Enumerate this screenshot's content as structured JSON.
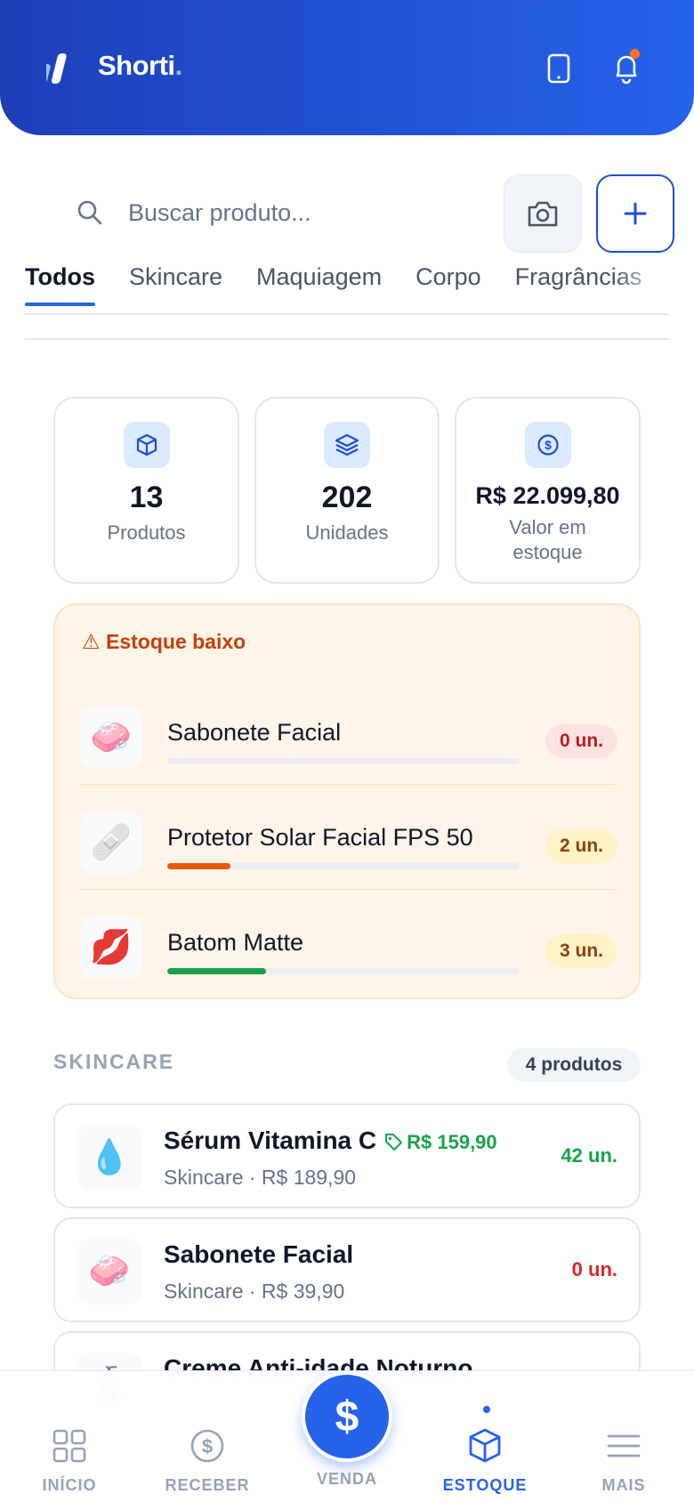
{
  "app": {
    "name": "Shorti",
    "name_dot": "."
  },
  "header": {
    "device_icon": "smartphone-icon",
    "notification_icon": "bell-icon",
    "notification_dot_color": "#f97316"
  },
  "search": {
    "placeholder": "Buscar produto...",
    "value": ""
  },
  "tabs": [
    {
      "label": "Todos",
      "active": true
    },
    {
      "label": "Skincare",
      "active": false
    },
    {
      "label": "Maquiagem",
      "active": false
    },
    {
      "label": "Corpo",
      "active": false
    },
    {
      "label": "Fragrâncias",
      "active": false
    }
  ],
  "stats": [
    {
      "icon": "box-icon",
      "value": "13",
      "label": "Produtos"
    },
    {
      "icon": "layers-icon",
      "value": "202",
      "label": "Unidades"
    },
    {
      "icon": "dollar-circle-icon",
      "value": "R$ 22.099,80",
      "label": "Valor em estoque"
    }
  ],
  "low_stock": {
    "title": "⚠ Estoque baixo",
    "items": [
      {
        "emoji": "🧼",
        "name": "Sabonete Facial",
        "qty": "0 un.",
        "level": 0,
        "bar_color": "#e2e8f0",
        "badge_bg": "#fde2e2",
        "badge_color": "#b91c1c"
      },
      {
        "emoji": "🩹",
        "name": "Protetor Solar Facial FPS 50",
        "qty": "2 un.",
        "level": 0.18,
        "bar_color": "#ea580c",
        "badge_bg": "#fef3c7",
        "badge_color": "#92400e"
      },
      {
        "emoji": "💋",
        "name": "Batom Matte",
        "qty": "3 un.",
        "level": 0.28,
        "bar_color": "#16a34a",
        "badge_bg": "#fef3c7",
        "badge_color": "#92400e"
      }
    ]
  },
  "section": {
    "title": "SKINCARE",
    "count": "4 produtos"
  },
  "products": [
    {
      "emoji": "💧",
      "name": "Sérum Vitamina C",
      "promo_price": "R$ 159,90",
      "meta": "Skincare · R$ 189,90",
      "qty": "42 un.",
      "qty_color": "#16a34a"
    },
    {
      "emoji": "🧼",
      "name": "Sabonete Facial",
      "promo_price": "",
      "meta": "Skincare · R$ 39,90",
      "qty": "0 un.",
      "qty_color": "#dc2626"
    },
    {
      "emoji": "🧴",
      "name": "Creme Anti-idade Noturno",
      "promo_price": "",
      "meta": "",
      "qty": "",
      "qty_color": "#16a34a"
    }
  ],
  "bottom_nav": [
    {
      "label": "INÍCIO",
      "icon": "grid-icon",
      "active": false
    },
    {
      "label": "RECEBER",
      "icon": "dollar-circle-icon",
      "active": false
    },
    {
      "label": "VENDA",
      "icon": "dollar-icon",
      "active": false
    },
    {
      "label": "ESTOQUE",
      "icon": "box-icon",
      "active": true
    },
    {
      "label": "MAIS",
      "icon": "menu-icon",
      "active": false
    }
  ],
  "colors": {
    "primary": "#2563eb",
    "header_dark": "#1d3fb8"
  }
}
